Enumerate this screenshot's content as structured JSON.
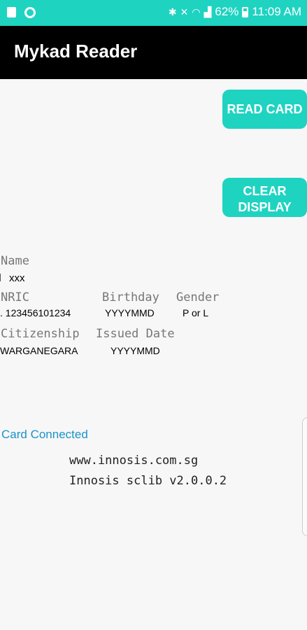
{
  "status_bar": {
    "battery": "62%",
    "time": "11:09 AM"
  },
  "app_bar": {
    "title": "Mykad Reader"
  },
  "buttons": {
    "read_card": "READ CARD",
    "clear_display": "CLEAR\nDISPLAY"
  },
  "fields": {
    "name_label": "Name",
    "name_value": "xxx",
    "nric_label": "NRIC",
    "nric_value": "123456101234",
    "birthday_label": "Birthday",
    "birthday_value": "YYYYMMD",
    "gender_label": "Gender",
    "gender_value": "P or L",
    "citizenship_label": "Citizenship",
    "citizenship_value": "WARGANEGARA",
    "issued_label": "Issued Date",
    "issued_value": "YYYYMMD"
  },
  "status": {
    "connection": "Card Connected"
  },
  "footer": {
    "website": "www.innosis.com.sg",
    "version": "Innosis sclib v2.0.0.2"
  }
}
